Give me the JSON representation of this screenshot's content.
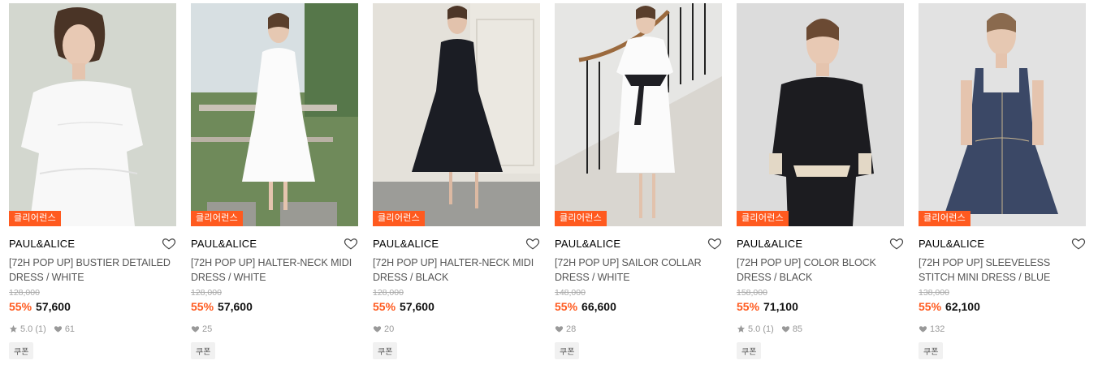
{
  "products": [
    {
      "badge": "클리어런스",
      "brand": "PAUL&ALICE",
      "name": "[72H POP UP] BUSTIER DETAILED DRESS / WHITE",
      "original_price": "128,000",
      "discount": "55%",
      "price": "57,600",
      "rating": "5.0",
      "review_count": "(1)",
      "likes": "61",
      "coupon": "쿠폰",
      "dress_color": "#ffffff"
    },
    {
      "badge": "클리어런스",
      "brand": "PAUL&ALICE",
      "name": "[72H POP UP] HALTER-NECK MIDI DRESS / WHITE",
      "original_price": "128,000",
      "discount": "55%",
      "price": "57,600",
      "rating": "",
      "review_count": "",
      "likes": "25",
      "coupon": "쿠폰",
      "dress_color": "#ffffff"
    },
    {
      "badge": "클리어런스",
      "brand": "PAUL&ALICE",
      "name": "[72H POP UP] HALTER-NECK MIDI DRESS / BLACK",
      "original_price": "128,000",
      "discount": "55%",
      "price": "57,600",
      "rating": "",
      "review_count": "",
      "likes": "20",
      "coupon": "쿠폰",
      "dress_color": "#1b1d24"
    },
    {
      "badge": "클리어런스",
      "brand": "PAUL&ALICE",
      "name": "[72H POP UP] SAILOR COLLAR DRESS / WHITE",
      "original_price": "148,000",
      "discount": "55%",
      "price": "66,600",
      "rating": "",
      "review_count": "",
      "likes": "28",
      "coupon": "쿠폰",
      "dress_color": "#ffffff"
    },
    {
      "badge": "클리어런스",
      "brand": "PAUL&ALICE",
      "name": "[72H POP UP] COLOR BLOCK DRESS / BLACK",
      "original_price": "158,000",
      "discount": "55%",
      "price": "71,100",
      "rating": "5.0",
      "review_count": "(1)",
      "likes": "85",
      "coupon": "쿠폰",
      "dress_color": "#1c1c20"
    },
    {
      "badge": "클리어런스",
      "brand": "PAUL&ALICE",
      "name": "[72H POP UP] SLEEVELESS STITCH MINI DRESS / BLUE",
      "original_price": "138,000",
      "discount": "55%",
      "price": "62,100",
      "rating": "",
      "review_count": "",
      "likes": "132",
      "coupon": "쿠폰",
      "dress_color": "#3b4866"
    }
  ],
  "colors": {
    "accent": "#ff5a1f",
    "muted": "#999999",
    "strike": "#aaaaaa"
  },
  "icons": {
    "wish": "heart-outline-icon",
    "rating": "star-icon",
    "likes": "heart-filled-icon"
  }
}
